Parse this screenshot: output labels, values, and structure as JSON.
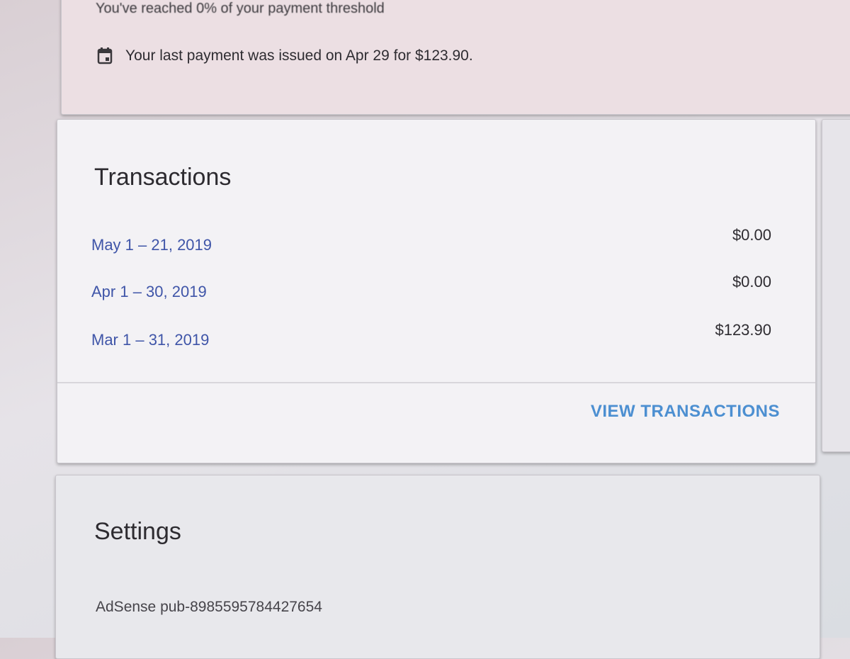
{
  "payment": {
    "threshold_text": "You've reached 0% of your payment threshold",
    "last_payment_text": "Your last payment was issued on Apr 29 for $123.90."
  },
  "transactions": {
    "title": "Transactions",
    "rows": [
      {
        "date": "May 1 – 21, 2019",
        "amount": "$0.00"
      },
      {
        "date": "Apr 1 – 30, 2019",
        "amount": "$0.00"
      },
      {
        "date": "Mar 1 – 31, 2019",
        "amount": "$123.90"
      }
    ],
    "view_label": "VIEW TRANSACTIONS"
  },
  "settings": {
    "title": "Settings",
    "adsense_id": "AdSense pub-8985595784427654"
  },
  "colors": {
    "link": "#3f55a8",
    "action": "#4c8fd1"
  }
}
